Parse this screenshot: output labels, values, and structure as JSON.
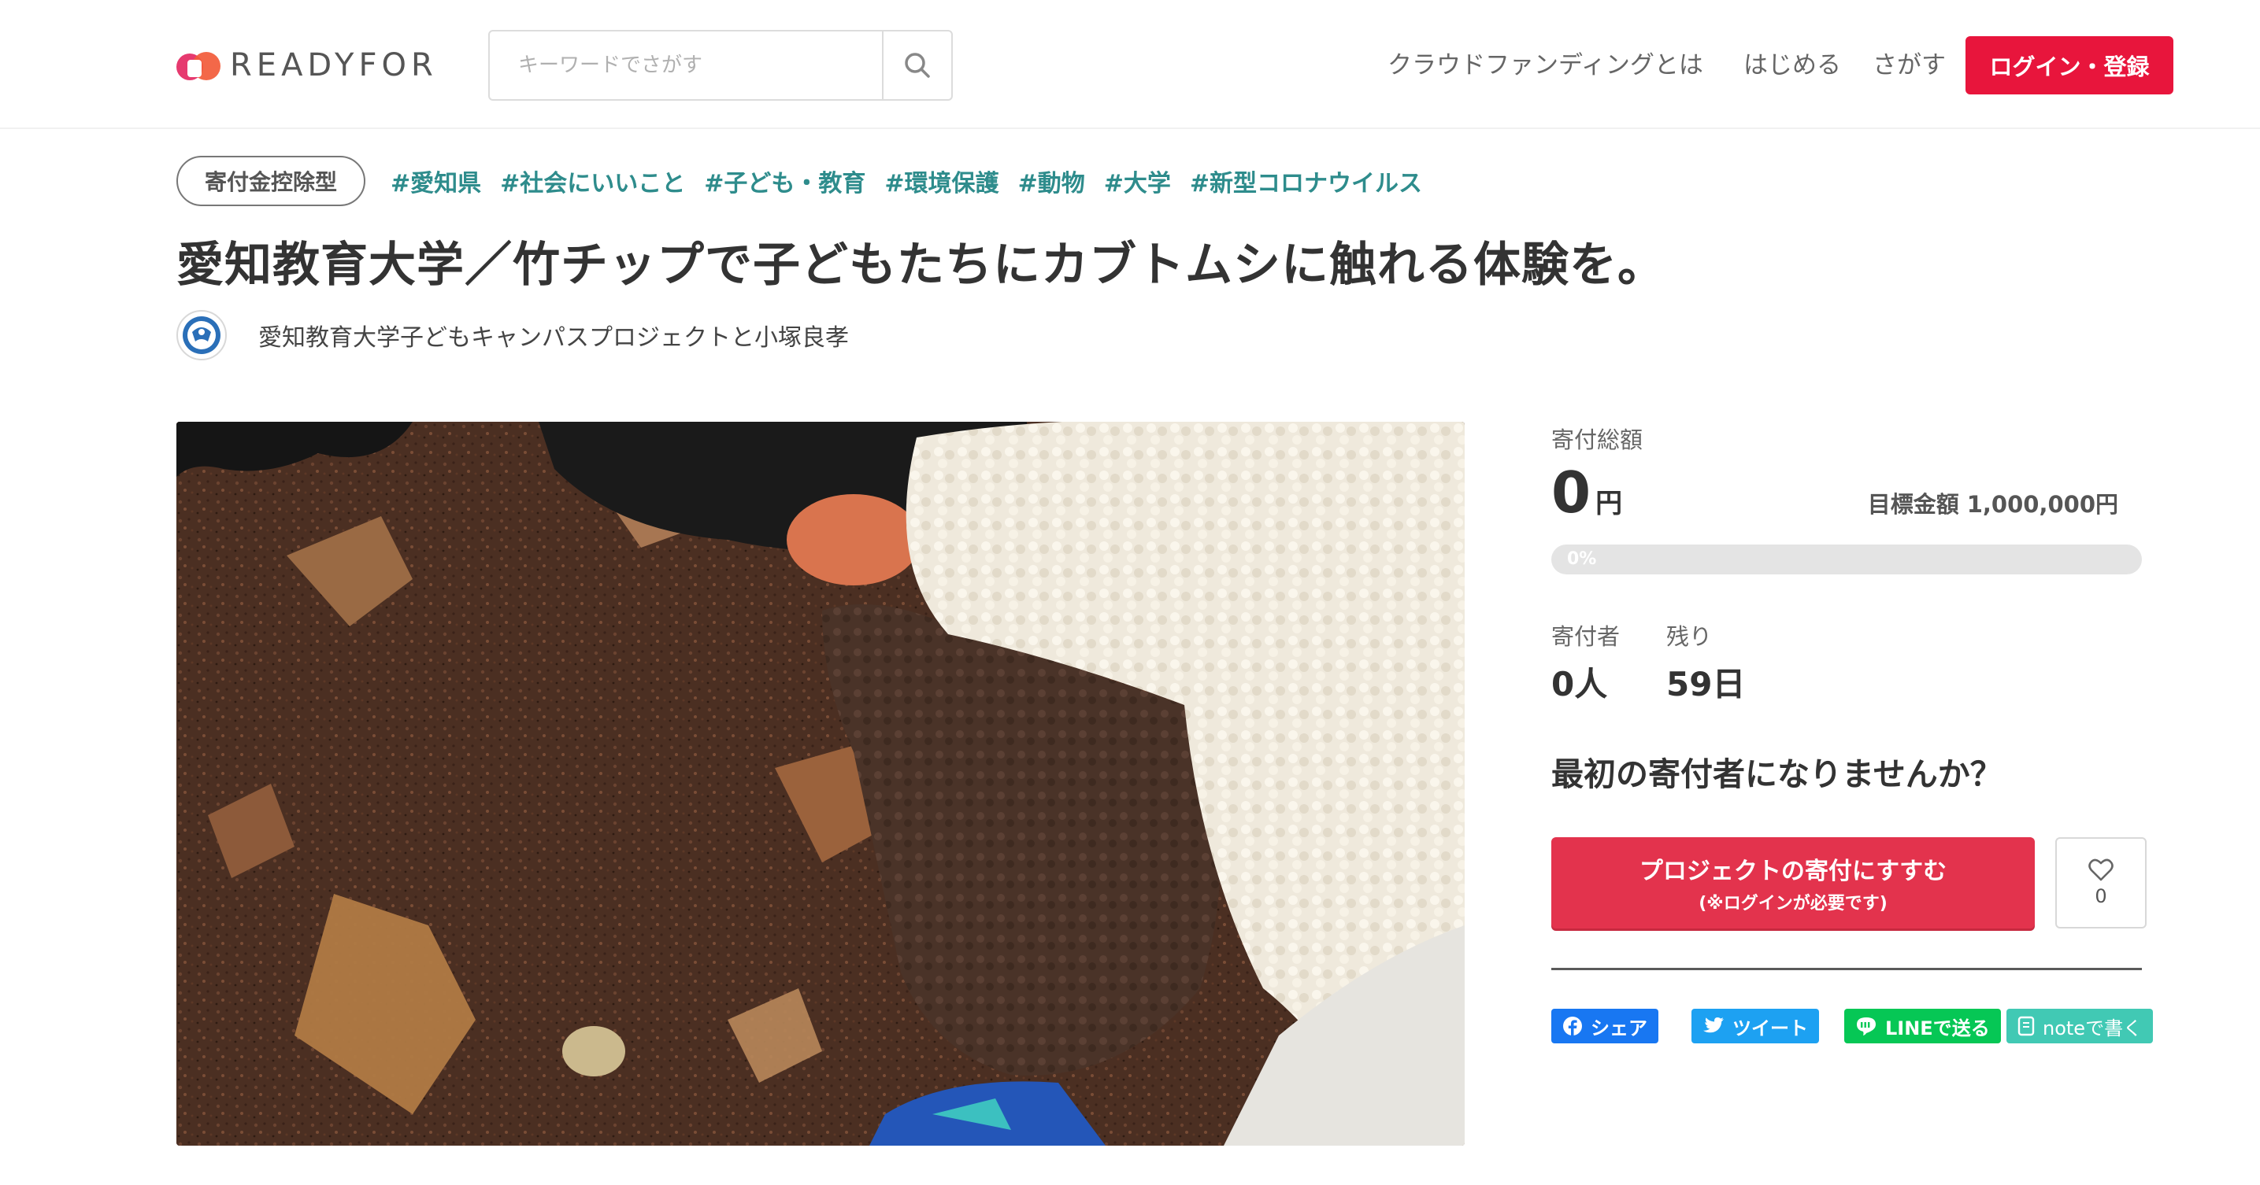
{
  "header": {
    "logo_text": "READYFOR",
    "search_placeholder": "キーワードでさがす",
    "nav": [
      "クラウドファンディングとは",
      "はじめる",
      "さがす"
    ],
    "login_label": "ログイン・登録"
  },
  "project": {
    "badge": "寄付金控除型",
    "tags": [
      "#愛知県",
      "#社会にいいこと",
      "#子ども・教育",
      "#環境保護",
      "#動物",
      "#大学",
      "#新型コロナウイルス"
    ],
    "title": "愛知教育大学／竹チップで子どもたちにカブトムシに触れる体験を。",
    "owner": "愛知教育大学子どもキャンパスプロジェクトと小塚良孝"
  },
  "panel": {
    "amount_label": "寄付総額",
    "amount": "0",
    "amount_unit": "円",
    "goal_label": "目標金額",
    "goal_value": "1,000,000円",
    "progress_text": "0%",
    "progress_fraction": 0,
    "donors_label": "寄付者",
    "donors_value": "0人",
    "remaining_label": "残り",
    "remaining_value": "59日",
    "cta_text": "最初の寄付者になりませんか？",
    "donate_label": "プロジェクトの寄付にすすむ",
    "donate_sub": "(※ログインが必要です)",
    "favorite_count": "0",
    "share": {
      "facebook": "シェア",
      "twitter": "ツイート",
      "line": "LINEで送る",
      "note": "noteで書く"
    }
  },
  "colors": {
    "brand_red": "#e8153c",
    "donate_red": "#e3334d",
    "tag_teal": "#2e8c8c",
    "facebook": "#1877f2",
    "twitter": "#1da1f2",
    "line": "#06c755",
    "note": "#41c9b4"
  },
  "icons": [
    "search-icon",
    "heart-icon",
    "facebook-icon",
    "twitter-icon",
    "line-icon",
    "note-icon"
  ]
}
